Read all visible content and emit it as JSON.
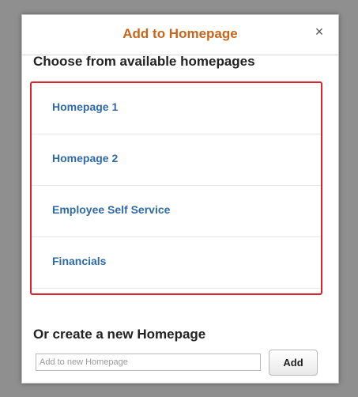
{
  "dialog": {
    "title": "Add to Homepage",
    "close_glyph": "×",
    "subtitle": "Choose from available homepages",
    "homepages": [
      {
        "label": "Homepage 1"
      },
      {
        "label": "Homepage 2"
      },
      {
        "label": "Employee Self Service"
      },
      {
        "label": "Financials"
      }
    ],
    "create_label": "Or create a new Homepage",
    "new_homepage_input": {
      "value": "",
      "placeholder": "Add to new Homepage"
    },
    "add_button_label": "Add",
    "icons": {
      "close": "close-icon"
    },
    "colors": {
      "title": "#c8651c",
      "link": "#2f6aa8",
      "highlight_border": "#d8262c"
    }
  }
}
